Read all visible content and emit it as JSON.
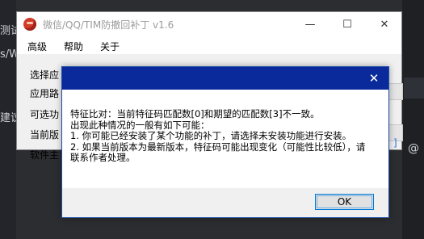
{
  "background": {
    "left_text_1": "测试",
    "left_text_2": "s/W",
    "left_text_3": "建议",
    "right_glyph": "@"
  },
  "window": {
    "title": "微信/QQ/TIM防撤回补丁 v1.6",
    "controls": {
      "minimize": "—",
      "maximize": "☐",
      "close": "✕"
    },
    "menu": [
      "高级",
      "帮助",
      "关于"
    ],
    "rows": [
      "选择应",
      "应用路",
      "可选功",
      "当前版",
      "软件主"
    ],
    "bracket_text": "]"
  },
  "dialog": {
    "close": "✕",
    "message": "特征比对：当前特征码匹配数[0]和期望的匹配数[3]不一致。\n出现此种情况的一般有如下可能：\n1. 你可能已经安装了某个功能的补丁，请选择未安装功能进行安装。\n2. 如果当前版本为最新版本，特征码可能出现变化（可能性比较低），请联系作者处理。",
    "ok_label": "OK"
  },
  "colors": {
    "dialog_title_bar": "#0a2a9c",
    "accent_link": "#2a6fd8",
    "ok_border": "#0078d7"
  }
}
